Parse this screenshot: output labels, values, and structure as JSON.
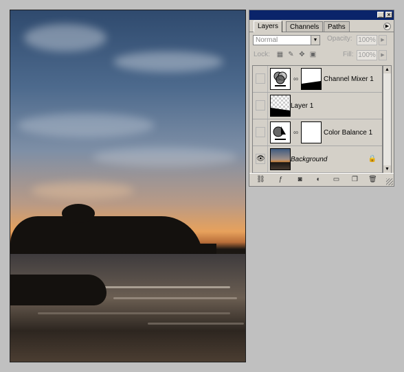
{
  "palette": {
    "tabs": [
      "Layers",
      "Channels",
      "Paths"
    ],
    "active_tab": "Layers",
    "blend_mode": "Normal",
    "opacity_label": "Opacity:",
    "opacity_value": "100%",
    "lock_label": "Lock:",
    "fill_label": "Fill:",
    "fill_value": "100%",
    "layers": [
      {
        "name": "Channel Mixer 1",
        "visible": false,
        "type": "adjustment"
      },
      {
        "name": "Layer 1",
        "visible": false,
        "type": "pixel"
      },
      {
        "name": "Color Balance 1",
        "visible": false,
        "type": "adjustment"
      },
      {
        "name": "Background",
        "visible": true,
        "type": "background",
        "locked": true
      }
    ],
    "bottom_icons": [
      "link-layers-icon",
      "layer-style-icon",
      "add-mask-icon",
      "new-fill-adjustment-icon",
      "new-group-icon",
      "new-layer-icon",
      "delete-layer-icon"
    ]
  },
  "colors": {
    "titlebar": "#0a246a",
    "panel": "#d4d0c8",
    "desktop": "#c0c0c0"
  }
}
